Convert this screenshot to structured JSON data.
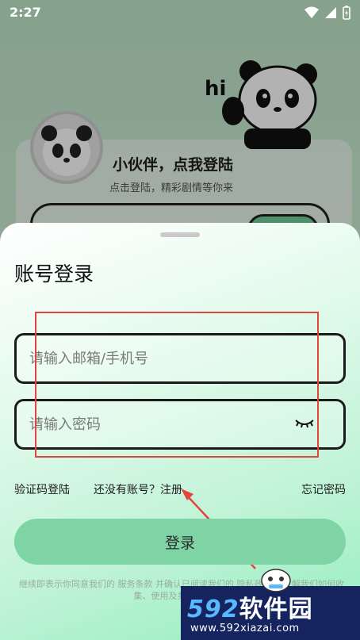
{
  "status_bar": {
    "time": "2:27"
  },
  "background": {
    "title": "小伙伴，点我登陆",
    "subtitle": "点击登陆，精彩剧情等你来",
    "hi_text": "hi"
  },
  "sheet": {
    "title": "账号登录",
    "email_placeholder": "请输入邮箱/手机号",
    "email_value": "",
    "password_placeholder": "请输入密码",
    "password_value": "",
    "sms_login_link": "验证码登陆",
    "no_account_text": "还没有账号？",
    "register_link": "注册",
    "forgot_password_link": "忘记密码",
    "login_button": "登录",
    "terms_text": "继续即表示你同意我们的 服务条款 并确认已阅读我们的 隐私政策 以了解我们如何收集、使用及共享你的信息"
  },
  "watermark": {
    "num": "592",
    "brand": "软件园",
    "url": "www.592xiazai.com"
  },
  "colors": {
    "accent_green": "#7fd4a5",
    "annotation_red": "#e0463c",
    "watermark_blue": "#15245f"
  }
}
